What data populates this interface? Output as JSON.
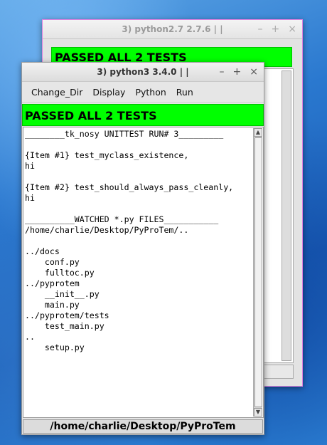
{
  "back_window": {
    "title": "3) python2.7 2.7.6 | |",
    "controls": {
      "minimize": "–",
      "maximize": "+",
      "close": "×"
    },
    "banner": "PASSED ALL 2 TESTS"
  },
  "front_window": {
    "title": "3) python3 3.4.0 | |",
    "controls": {
      "minimize": "–",
      "maximize": "+",
      "close": "×"
    },
    "menu": [
      "Change_Dir",
      "Display",
      "Python",
      "Run"
    ],
    "banner": "PASSED ALL 2 TESTS",
    "output_text": "________tk_nosy UNITTEST RUN# 3_________\n\n{Item #1} test_myclass_existence,\nhi\n\n{Item #2} test_should_always_pass_cleanly,\nhi\n\n__________WATCHED *.py FILES___________\n/home/charlie/Desktop/PyProTem/..\n\n../docs\n    conf.py\n    fulltoc.py\n../pyprotem\n    __init__.py\n    main.py\n../pyprotem/tests\n    test_main.py\n..\n    setup.py",
    "status_path": "/home/charlie/Desktop/PyProTem"
  },
  "colors": {
    "banner_green": "#00ff00",
    "window_bg": "#e6e6e6"
  }
}
